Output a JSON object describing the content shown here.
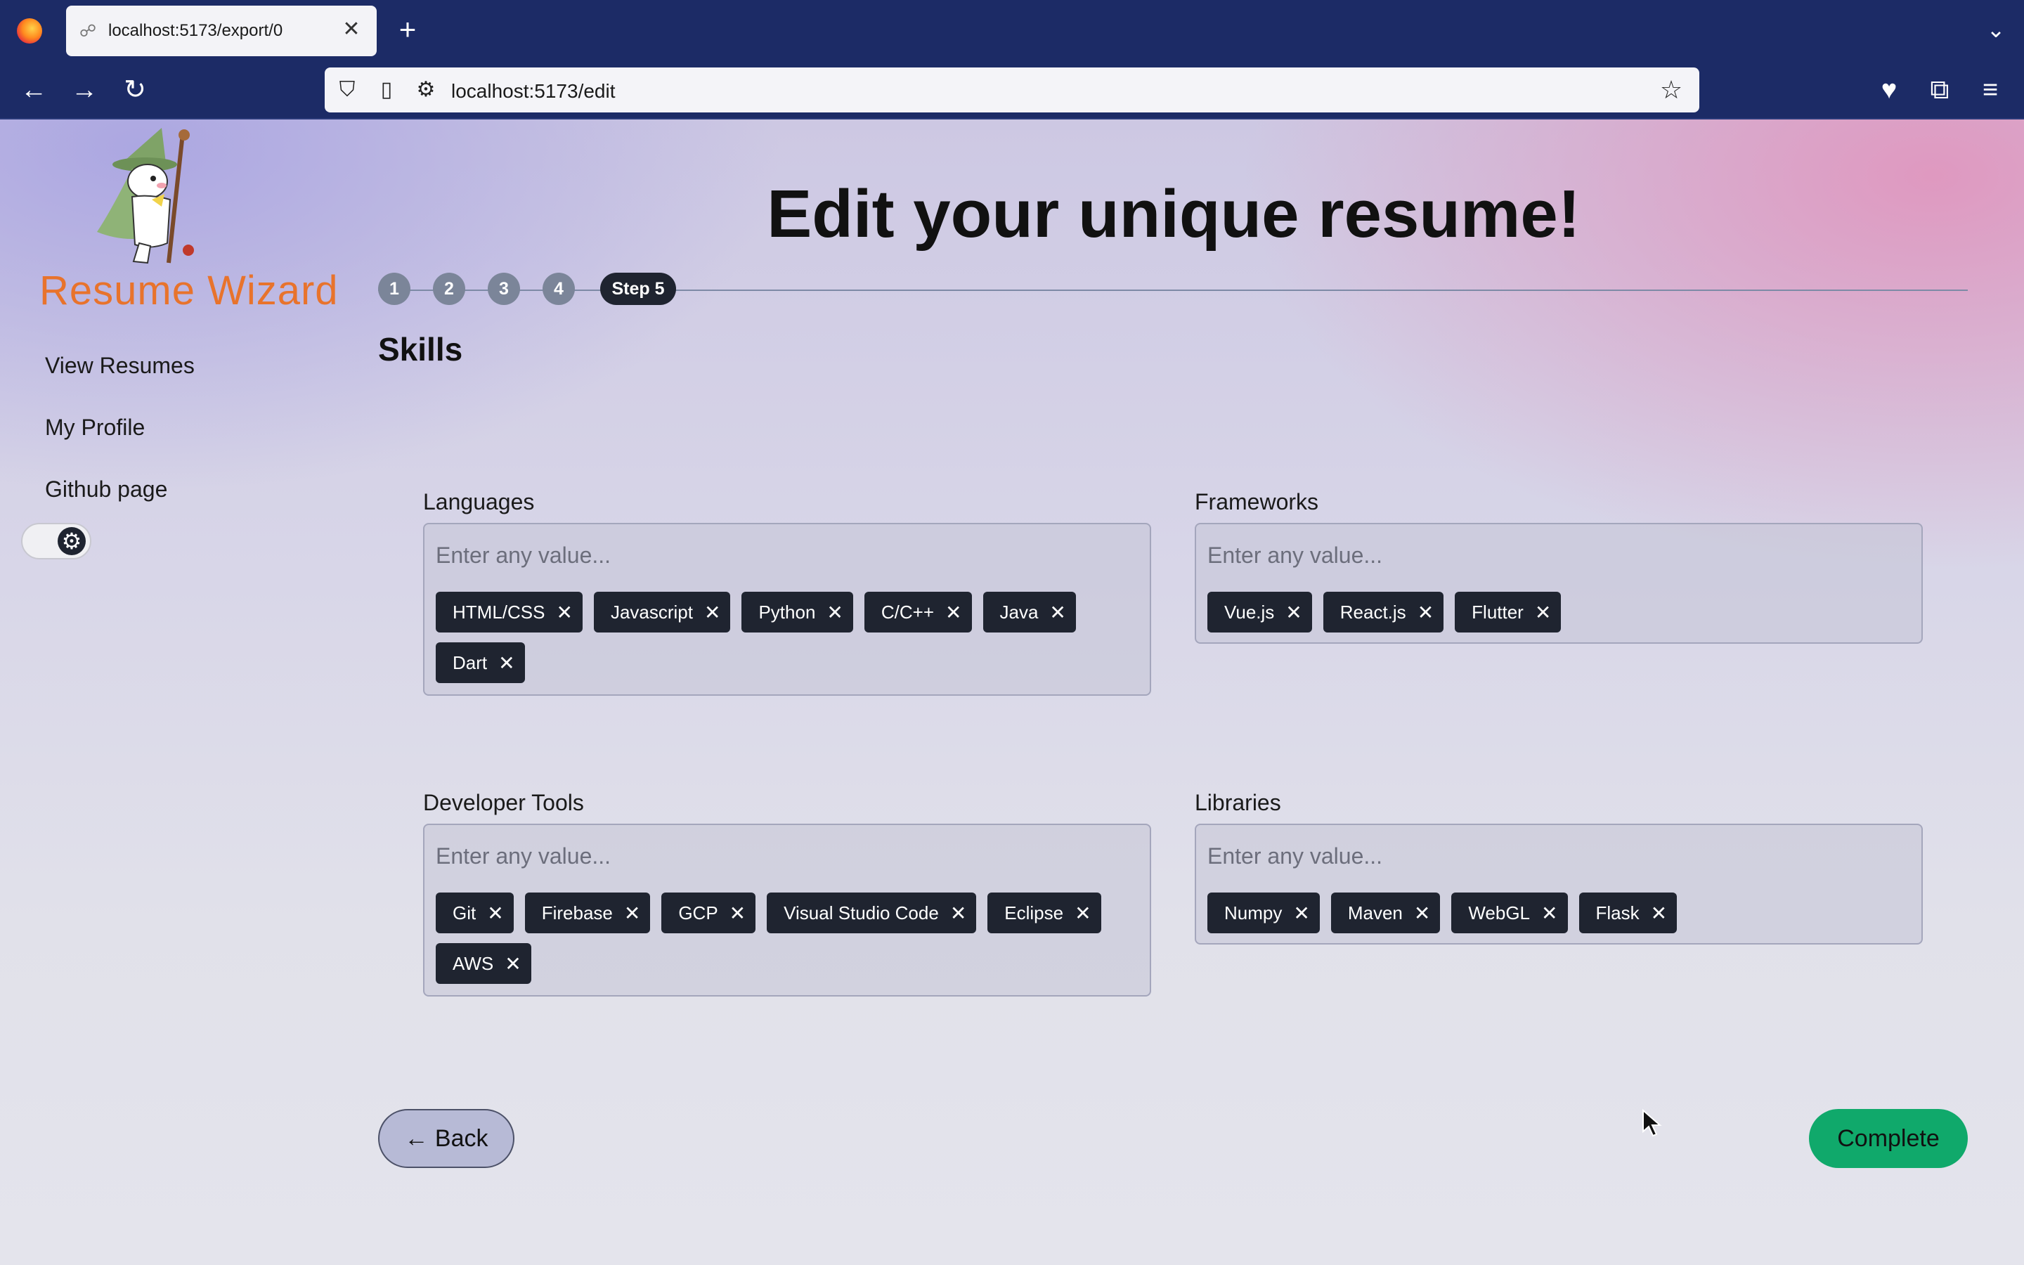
{
  "browser": {
    "tab_title": "localhost:5173/export/0",
    "tab_close": "✕",
    "new_tab": "+",
    "tab_list": "⌄",
    "url": "localhost:5173/edit",
    "nav": {
      "back": "←",
      "forward": "→",
      "reload": "↻"
    },
    "url_icons": {
      "shield": "⛉",
      "page": "▯",
      "permissions": "⚙",
      "bookmark": "☆"
    },
    "toolbar_icons": {
      "pocket": "♥",
      "extensions": "⧉",
      "menu": "≡"
    }
  },
  "sidebar": {
    "brand": "Resume Wizard",
    "links": [
      "View Resumes",
      "My Profile",
      "Github page"
    ],
    "theme_toggle_icon": "⚙"
  },
  "main": {
    "title": "Edit your unique resume!",
    "steps": [
      "1",
      "2",
      "3",
      "4"
    ],
    "active_step": "Step 5",
    "section": "Skills"
  },
  "fields": {
    "placeholder": "Enter any value...",
    "remove_glyph": "✕",
    "languages": {
      "label": "Languages",
      "tags": [
        "HTML/CSS",
        "Javascript",
        "Python",
        "C/C++",
        "Java",
        "Dart"
      ]
    },
    "frameworks": {
      "label": "Frameworks",
      "tags": [
        "Vue.js",
        "React.js",
        "Flutter"
      ]
    },
    "developer_tools": {
      "label": "Developer Tools",
      "tags": [
        "Git",
        "Firebase",
        "GCP",
        "Visual Studio Code",
        "Eclipse",
        "AWS"
      ]
    },
    "libraries": {
      "label": "Libraries",
      "tags": [
        "Numpy",
        "Maven",
        "WebGL",
        "Flask"
      ]
    }
  },
  "buttons": {
    "back": "← Back",
    "complete": "Complete"
  },
  "colors": {
    "brand": "#e8732c",
    "chip": "#1f2430",
    "complete": "#10a96b",
    "browser_chrome": "#1c2b66"
  }
}
